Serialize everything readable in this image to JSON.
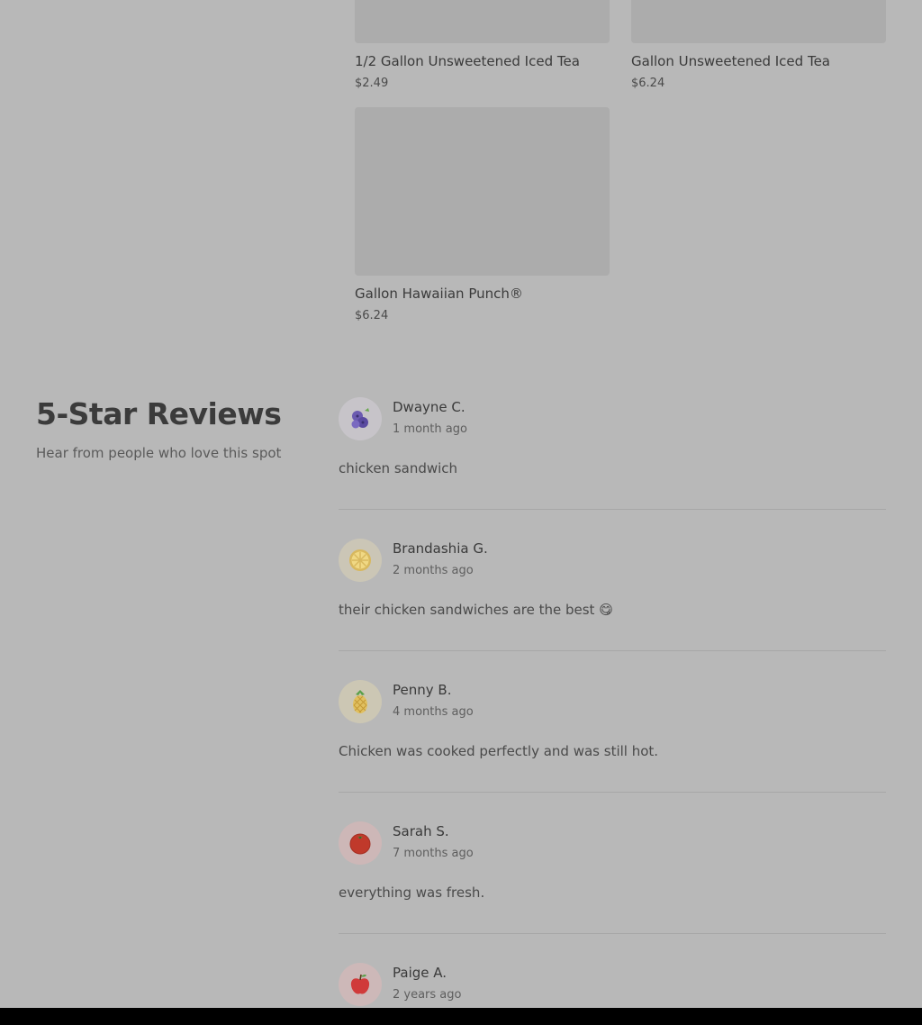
{
  "products": [
    {
      "name": "1/2 Gallon Unsweetened Iced Tea",
      "price": "$2.49"
    },
    {
      "name": "Gallon Unsweetened Iced Tea",
      "price": "$6.24"
    },
    {
      "name": "Gallon Hawaiian Punch®",
      "price": "$6.24"
    }
  ],
  "reviews_section": {
    "title": "5-Star Reviews",
    "subtitle": "Hear from people who love this spot"
  },
  "reviews": [
    {
      "name": "Dwayne C.",
      "time": "1 month ago",
      "text": "chicken sandwich",
      "avatar_icon": "blueberry-icon",
      "avatar_bg": "#c7c4c9"
    },
    {
      "name": "Brandashia G.",
      "time": "2 months ago",
      "text": "their chicken sandwiches are the best 😋",
      "avatar_icon": "lemon-icon",
      "avatar_bg": "#cbc6b6"
    },
    {
      "name": "Penny B.",
      "time": "4 months ago",
      "text": "Chicken was cooked perfectly and was still hot.",
      "avatar_icon": "pineapple-icon",
      "avatar_bg": "#ccc7b4"
    },
    {
      "name": "Sarah S.",
      "time": "7 months ago",
      "text": "everything was fresh.",
      "avatar_icon": "tomato-icon",
      "avatar_bg": "#cdb7b7"
    },
    {
      "name": "Paige A.",
      "time": "2 years ago",
      "text": "",
      "avatar_icon": "apple-icon",
      "avatar_bg": "#cdb8b8"
    }
  ]
}
